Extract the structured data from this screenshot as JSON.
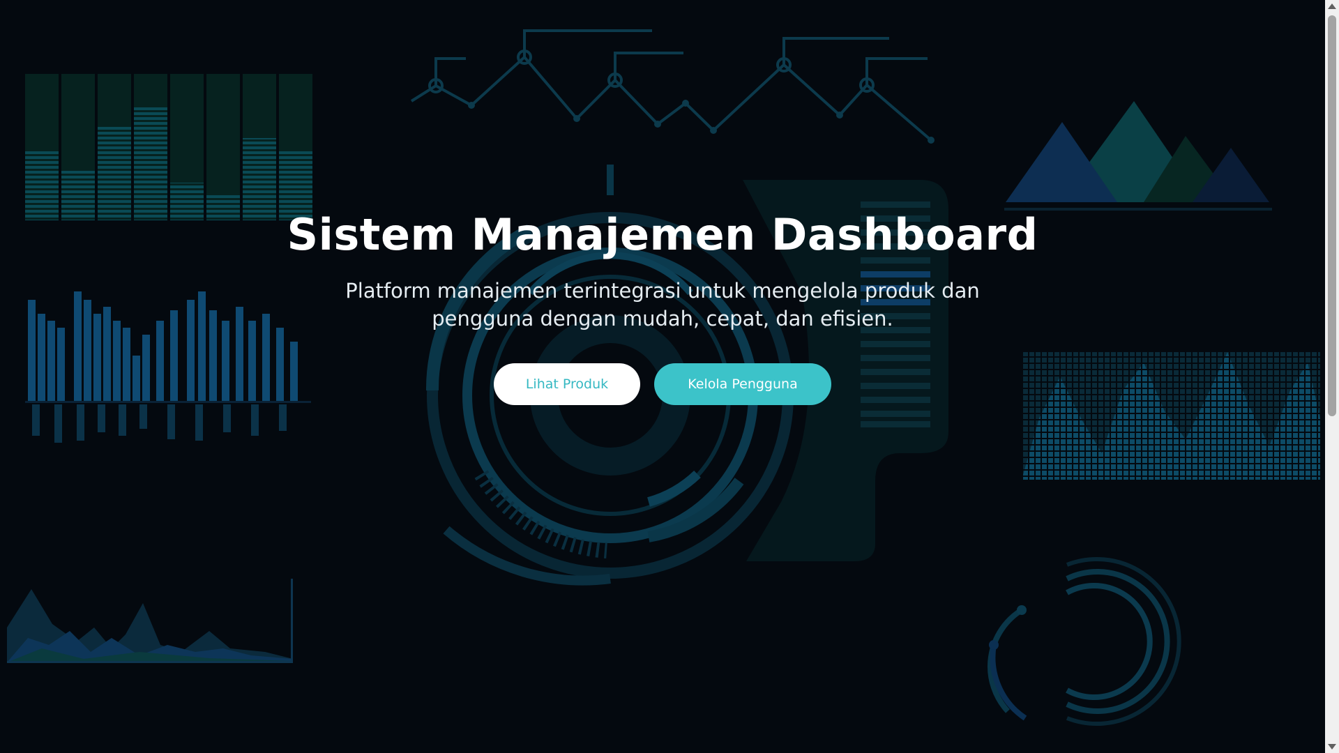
{
  "hero": {
    "title": "Sistem Manajemen Dashboard",
    "subtitle": "Platform manajemen terintegrasi untuk mengelola produk dan pengguna dengan mudah, cepat, dan efisien.",
    "primary_button_label": "Lihat Produk",
    "secondary_button_label": "Kelola Pengguna"
  },
  "colors": {
    "background": "#04090f",
    "accent": "#3cc3c9",
    "primary_button_text": "#35b8c2"
  }
}
